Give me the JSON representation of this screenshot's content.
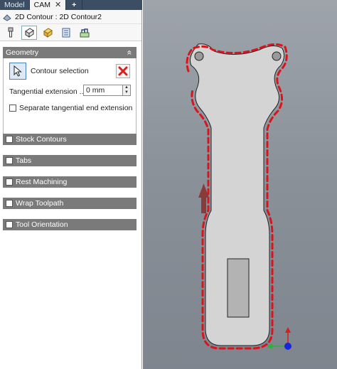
{
  "tabs": [
    {
      "label": "Model"
    },
    {
      "label": "CAM"
    }
  ],
  "tab_close": "✕",
  "tab_add": "+",
  "operation_title": "2D Contour : 2D Contour2",
  "geometry": {
    "header": "Geometry",
    "collapse_glyph": "«",
    "contour_selection_label": "Contour selection",
    "tangential_label": "Tangential extension ...",
    "tangential_value": "0 mm",
    "separate_label": "Separate tangential end extension"
  },
  "sections": [
    {
      "label": "Stock Contours"
    },
    {
      "label": "Tabs"
    },
    {
      "label": "Rest Machining"
    },
    {
      "label": "Wrap Toolpath"
    },
    {
      "label": "Tool Orientation"
    }
  ],
  "colors": {
    "toolpath": "#d9141a",
    "direction_arrow": "#8b3a3a",
    "part_fill": "#d4d4d4",
    "axis_x": "#2eae3a",
    "axis_y": "#d51e1e",
    "axis_z": "#1a26d9"
  }
}
